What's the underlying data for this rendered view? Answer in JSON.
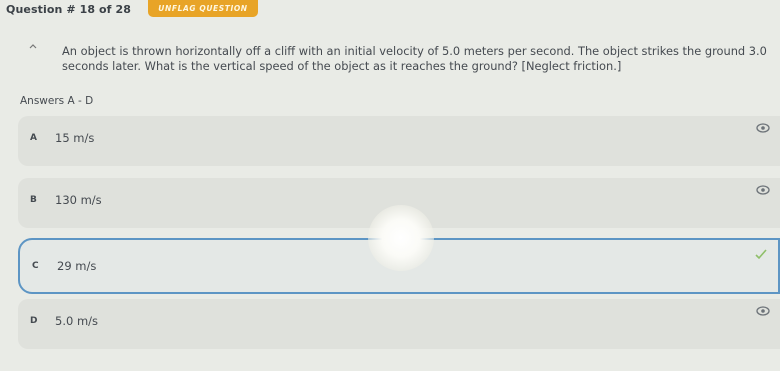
{
  "header": {
    "question_number": "Question # 18 of 28",
    "flag_button": "UNFLAG QUESTION"
  },
  "question": {
    "text": "An object is thrown horizontally off a cliff with an initial velocity of 5.0 meters per second. The object strikes the ground 3.0 seconds later. What is the vertical speed of the object as it reaches the ground? [Neglect friction.]"
  },
  "answers_label": "Answers A - D",
  "choices": [
    {
      "letter": "A",
      "text": "15 m/s",
      "mark_icon": "eye-icon"
    },
    {
      "letter": "B",
      "text": "130 m/s",
      "mark_icon": "eye-icon"
    },
    {
      "letter": "C",
      "text": "29 m/s",
      "mark_icon": "check-icon",
      "selected": true
    },
    {
      "letter": "D",
      "text": "5.0 m/s",
      "mark_icon": "eye-icon"
    }
  ],
  "colors": {
    "flag": "#e8a427",
    "selected_border": "#5d95c4",
    "check": "#8fbf6a"
  }
}
